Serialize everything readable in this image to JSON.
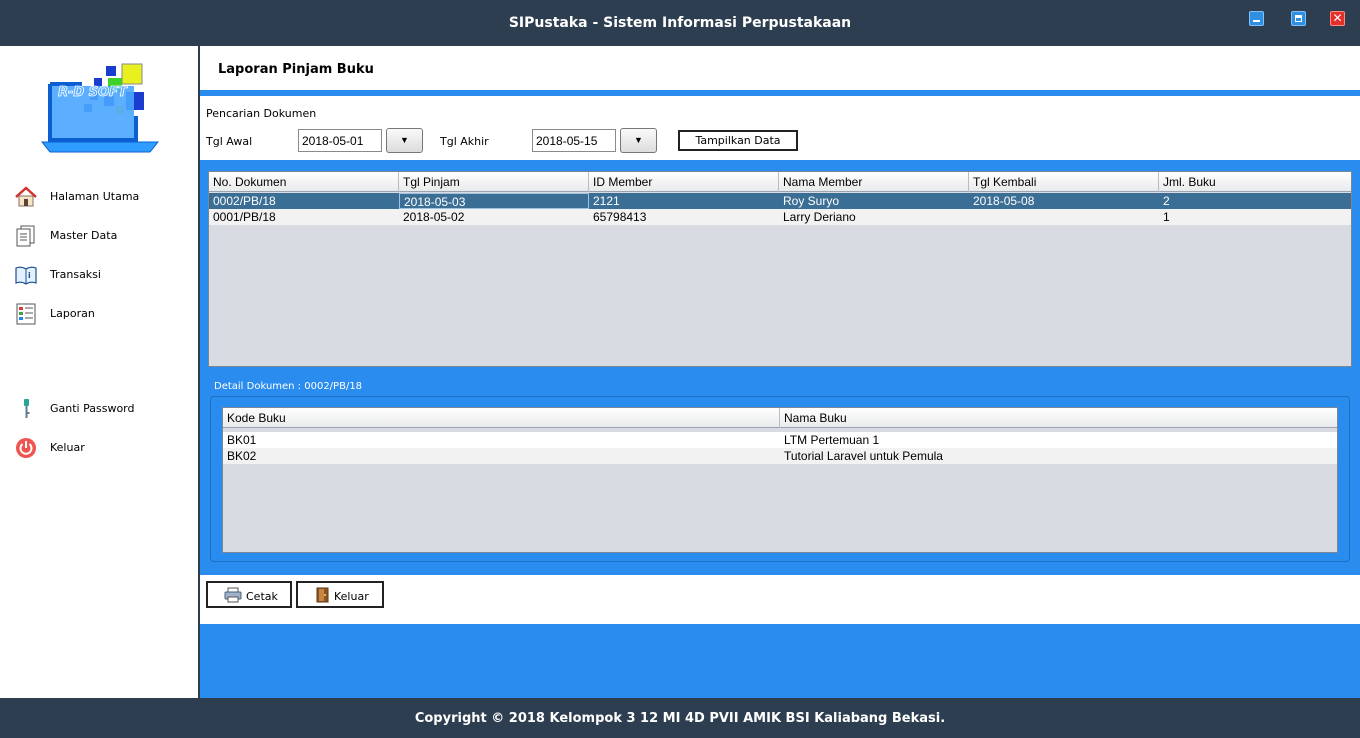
{
  "window": {
    "title": "SIPustaka - Sistem Informasi Perpustakaan",
    "close_glyph": "✕"
  },
  "sidebar": {
    "logo_text": "R-D SOFT",
    "items": [
      {
        "label": "Halaman Utama",
        "icon": "home-icon"
      },
      {
        "label": "Master Data",
        "icon": "document-icon"
      },
      {
        "label": "Transaksi",
        "icon": "book-icon"
      },
      {
        "label": "Laporan",
        "icon": "report-icon"
      },
      {
        "label": "Ganti Password",
        "icon": "key-icon"
      },
      {
        "label": "Keluar",
        "icon": "power-icon"
      }
    ]
  },
  "page": {
    "title": "Laporan Pinjam Buku"
  },
  "search": {
    "caption": "Pencarian Dokumen",
    "start_label": "Tgl Awal",
    "start_value": "2018-05-01",
    "end_label": "Tgl Akhir",
    "end_value": "2018-05-15",
    "dropdown_glyph": "▼",
    "show_button": "Tampilkan Data"
  },
  "documents": {
    "columns": [
      "No. Dokumen",
      "Tgl Pinjam",
      "ID Member",
      "Nama Member",
      "Tgl Kembali",
      "Jml. Buku"
    ],
    "rows": [
      [
        "0002/PB/18",
        "2018-05-03",
        "2121",
        "Roy Suryo",
        "2018-05-08",
        "2"
      ],
      [
        "0001/PB/18",
        "2018-05-02",
        "65798413",
        "Larry Deriano",
        "",
        "1"
      ]
    ],
    "selected_row": 0
  },
  "detail": {
    "caption": "Detail Dokumen : 0002/PB/18",
    "columns": [
      "Kode Buku",
      "Nama Buku"
    ],
    "rows": [
      [
        "BK01",
        "LTM Pertemuan 1"
      ],
      [
        "BK02",
        "Tutorial Laravel untuk Pemula"
      ]
    ]
  },
  "actions": {
    "print_label": "Cetak",
    "exit_label": "Keluar"
  },
  "footer": {
    "text": "Copyright © 2018 Kelompok 3 12 MI 4D PVII AMIK BSI Kaliabang Bekasi."
  },
  "colors": {
    "primary_blue": "#2a8cef",
    "dark_bar": "#2c3e50",
    "selected_row": "#3b6e94",
    "table_bg": "#d8dbe1"
  }
}
